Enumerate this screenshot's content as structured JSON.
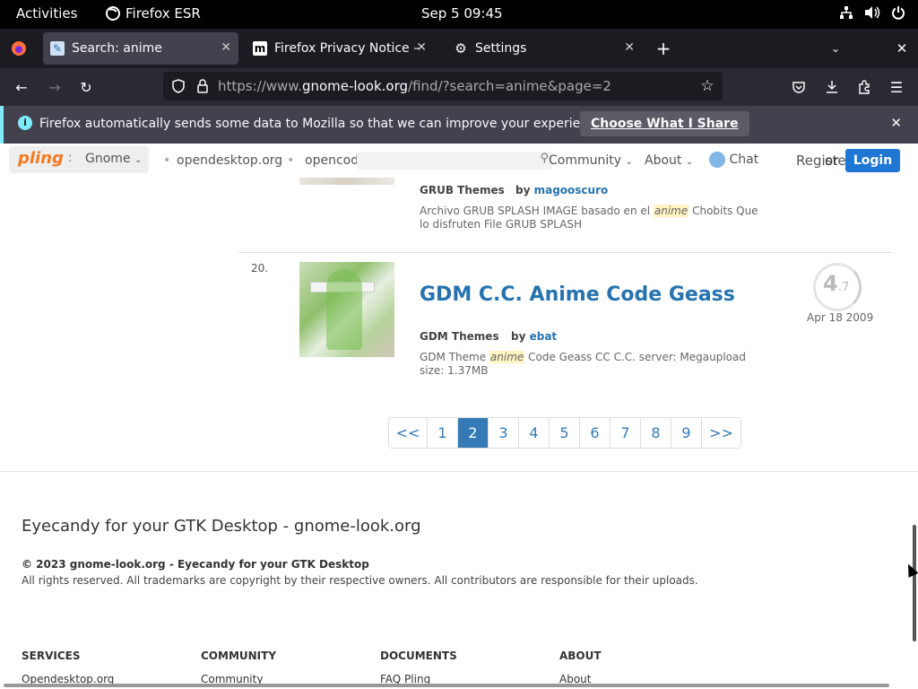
{
  "topbar": {
    "activities": "Activities",
    "app_name": "Firefox ESR",
    "clock": "Sep 5  09:45",
    "tray_icons": [
      "network-icon",
      "volume-icon",
      "power-icon"
    ]
  },
  "tabs": [
    {
      "title": "Search: anime",
      "icon": "gnome-look-icon",
      "active": true
    },
    {
      "title": "Firefox Privacy Notice — Mozilla",
      "icon": "mozilla-icon",
      "active": false
    },
    {
      "title": "Settings",
      "icon": "gear-icon",
      "active": false
    }
  ],
  "urlbar": {
    "prefix": "https://www.",
    "domain": "gnome-look.org",
    "path": "/find/?search=anime&page=2"
  },
  "notification": {
    "message": "Firefox automatically sends some data to Mozilla so that we can improve your experience.",
    "button": "Choose What I Share"
  },
  "site_header": {
    "logo": "pling",
    "store": "Gnome",
    "links": [
      "opendesktop.org",
      "opencode"
    ],
    "community": "Community",
    "about": "About",
    "chat": "Chat",
    "register": "Register",
    "or": "or",
    "login": "Login"
  },
  "results": [
    {
      "category": "GRUB Themes",
      "by": "by",
      "author": "magooscuro",
      "desc_before": "Archivo GRUB SPLASH IMAGE basado en el ",
      "desc_highlight": "anime",
      "desc_after": " Chobits Que lo disfruten File GRUB SPLASH"
    },
    {
      "rank": "20.",
      "title": "GDM C.C. Anime Code Geass",
      "category": "GDM Themes",
      "by": "by",
      "author": "ebat",
      "desc_before": "GDM Theme ",
      "desc_highlight": "anime",
      "desc_after": " Code Geass CC C.C. server: Megaupload size: 1.37MB",
      "rating_main": "4",
      "rating_dec": ".7",
      "rating_value": 4.7,
      "date": "Apr 18 2009"
    }
  ],
  "pagination": {
    "prev": "<<",
    "pages": [
      "1",
      "2",
      "3",
      "4",
      "5",
      "6",
      "7",
      "8",
      "9"
    ],
    "current": "2",
    "next": ">>"
  },
  "footer": {
    "title": "Eyecandy for your GTK Desktop - gnome-look.org",
    "copyright": "© 2023 gnome-look.org - Eyecandy for your GTK Desktop",
    "rights": "All rights reserved. All trademarks are copyright by their respective owners. All contributors are responsible for their uploads.",
    "columns": [
      {
        "heading": "SERVICES",
        "first_link": "Opendesktop.org"
      },
      {
        "heading": "COMMUNITY",
        "first_link": "Community"
      },
      {
        "heading": "DOCUMENTS",
        "first_link": "FAQ Pling"
      },
      {
        "heading": "ABOUT",
        "first_link": "About"
      }
    ]
  },
  "colors": {
    "link_blue": "#2673b0",
    "page_active": "#337ab7",
    "pling_orange": "#f47a20",
    "login_blue": "#1d77d3"
  }
}
